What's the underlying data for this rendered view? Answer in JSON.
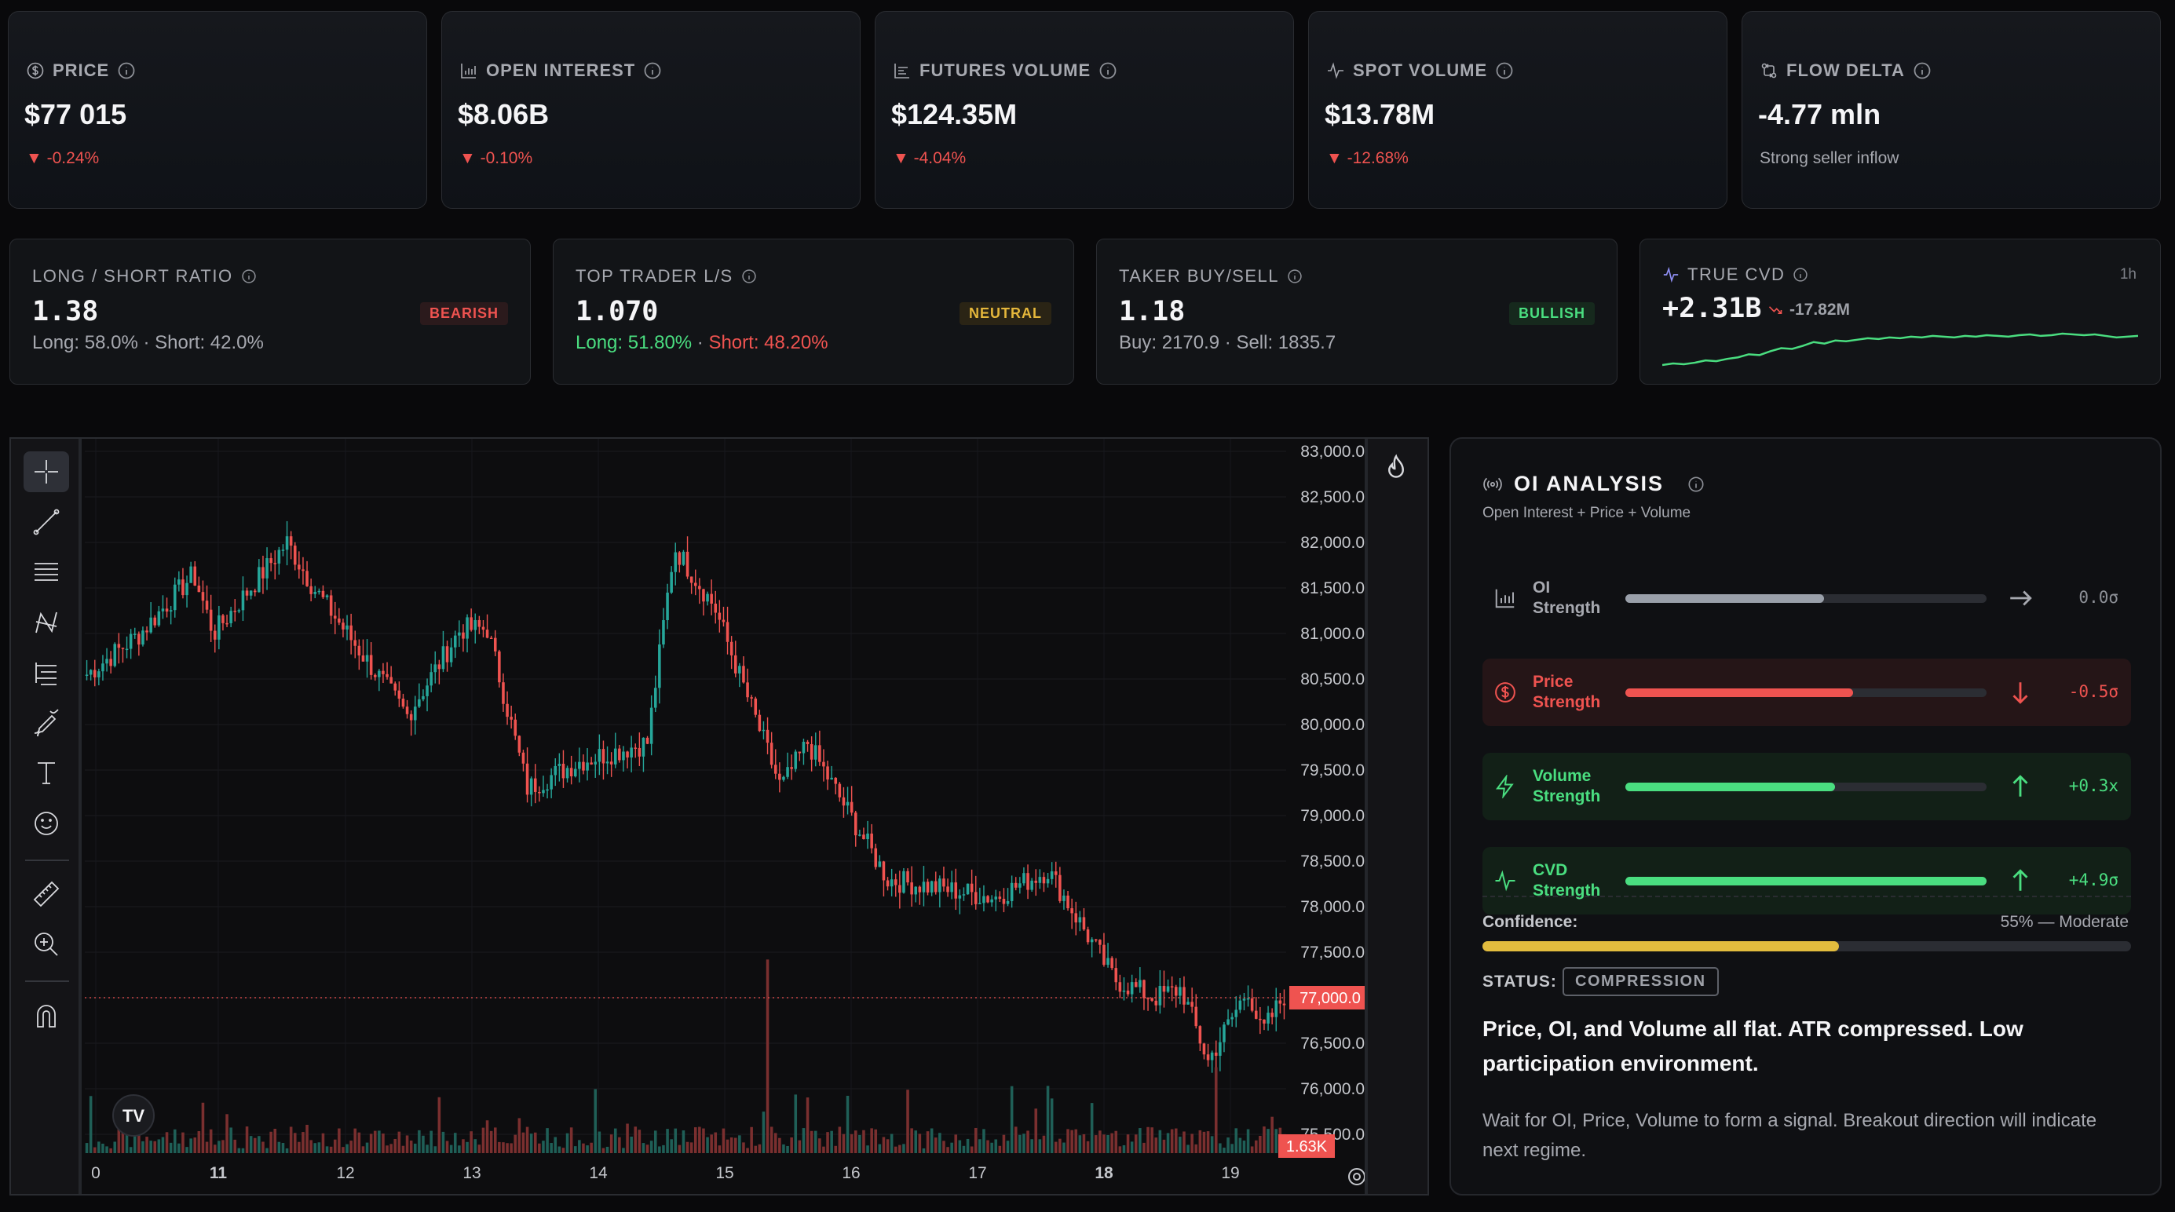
{
  "metrics": [
    {
      "label": "PRICE",
      "value": "$77 015",
      "change": "▼ -0.24%",
      "icon": "dollar-circle-icon"
    },
    {
      "label": "OPEN INTEREST",
      "value": "$8.06B",
      "change": "▼ -0.10%",
      "icon": "bar-chart-icon"
    },
    {
      "label": "FUTURES VOLUME",
      "value": "$124.35M",
      "change": "▼ -4.04%",
      "icon": "bars-icon"
    },
    {
      "label": "SPOT VOLUME",
      "value": "$13.78M",
      "change": "▼ -12.68%",
      "icon": "pulse-icon"
    },
    {
      "label": "FLOW DELTA",
      "value": "-4.77 mln",
      "note": "Strong seller inflow",
      "icon": "flow-icon"
    }
  ],
  "ratios": [
    {
      "label": "LONG / SHORT RATIO",
      "value": "1.38",
      "badge": "BEARISH",
      "sub_a": "Long: 58.0%",
      "sep": " · ",
      "sub_b": "Short: 42.0%"
    },
    {
      "label": "TOP TRADER L/S",
      "value": "1.070",
      "badge": "NEUTRAL",
      "sub_a": "Long: 51.80%",
      "sep": " · ",
      "sub_b": "Short: 48.20%"
    },
    {
      "label": "TAKER BUY/SELL",
      "value": "1.18",
      "badge": "BULLISH",
      "sub_a": "Buy: 2170.9",
      "sep": " · ",
      "sub_b": "Sell: 1835.7"
    }
  ],
  "cvd": {
    "label": "TRUE CVD",
    "timeframe": "1h",
    "value": "+2.31B",
    "change": "-17.82M",
    "spark": [
      0,
      2,
      1,
      3,
      6,
      5,
      8,
      10,
      14,
      13,
      18,
      22,
      21,
      25,
      30,
      28,
      32,
      31,
      33,
      35,
      34,
      36,
      35,
      37,
      36,
      38,
      37,
      36,
      38,
      37,
      39,
      38,
      37,
      39,
      40,
      38,
      39,
      41,
      40,
      39,
      40,
      38,
      36,
      37,
      38
    ]
  },
  "chart": {
    "price_ticks": [
      "83,000.0",
      "82,500.0",
      "82,000.0",
      "81,500.0",
      "81,000.0",
      "80,500.0",
      "80,000.0",
      "79,500.0",
      "79,000.0",
      "78,500.0",
      "78,000.0",
      "77,500.0",
      "77,000.0",
      "76,500.0",
      "76,000.0",
      "75,500.0"
    ],
    "current_price_label": "77,000.0",
    "volume_label": "1.63K",
    "date_ticks": [
      "0",
      "11",
      "12",
      "13",
      "14",
      "15",
      "16",
      "17",
      "18",
      "19"
    ],
    "logo": "TV",
    "colors": {
      "up": "#26a69a",
      "down": "#ef5350"
    }
  },
  "oi": {
    "title": "OI ANALYSIS",
    "subtitle": "Open Interest + Price + Volume",
    "rows": [
      {
        "label_a": "OI",
        "label_b": "Strength",
        "value": "0.0σ",
        "fill": 0.55,
        "tone": "neutral",
        "icon": "bar-chart-icon",
        "arrow": "arrow-right-icon"
      },
      {
        "label_a": "Price",
        "label_b": "Strength",
        "value": "-0.5σ",
        "fill": 0.63,
        "tone": "down",
        "icon": "dollar-circle-icon",
        "arrow": "arrow-down-icon"
      },
      {
        "label_a": "Volume",
        "label_b": "Strength",
        "value": "+0.3x",
        "fill": 0.58,
        "tone": "up",
        "icon": "bolt-icon",
        "arrow": "arrow-up-icon"
      },
      {
        "label_a": "CVD",
        "label_b": "Strength",
        "value": "+4.9σ",
        "fill": 1.0,
        "tone": "up",
        "icon": "pulse-icon",
        "arrow": "arrow-up-icon"
      }
    ],
    "confidence_label": "Confidence:",
    "confidence_value": "55% — Moderate",
    "confidence": 0.55,
    "status_label": "STATUS:",
    "status": "COMPRESSION",
    "description": "Price, OI, and Volume all flat. ATR compressed. Low participation environment.",
    "hint": "Wait for OI, Price, Volume to form a signal. Breakout direction will indicate next regime."
  }
}
